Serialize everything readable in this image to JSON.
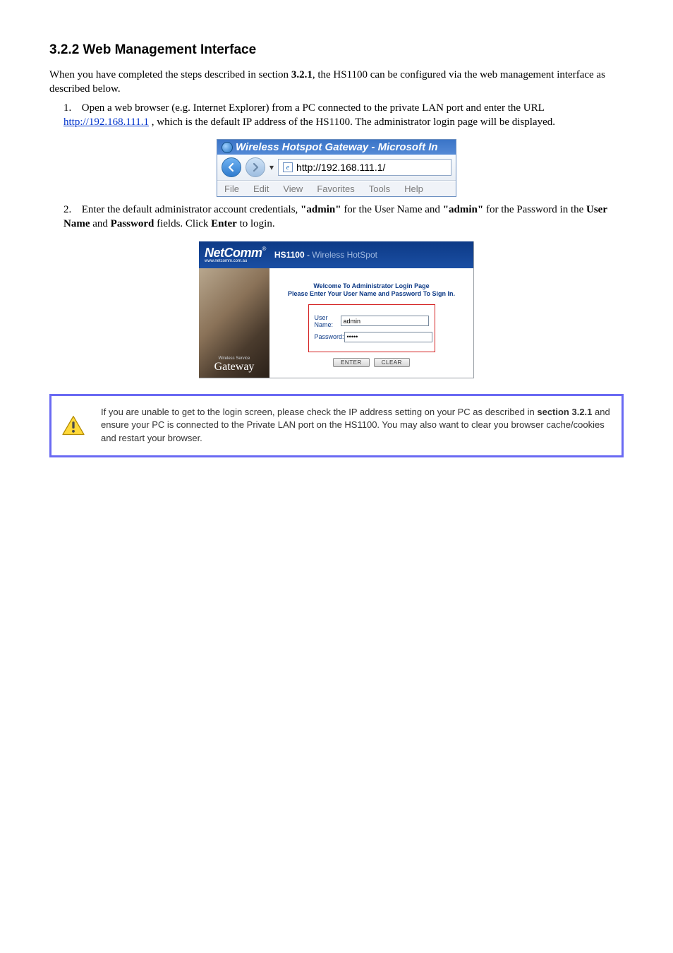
{
  "section_heading": "3.2.2 Web Management Interface",
  "intro_sentence_pre": "When you have completed the steps described in section ",
  "intro_sentence_ref": "3.2.1",
  "intro_sentence_post": ", the HS1100 can be configured via the web management interface as described below.",
  "steps": {
    "s1": {
      "text_pre": "Open a web browser (e.g. Internet Explorer) from a PC connected to the private LAN port and enter the URL ",
      "url": "http://192.168.111.1",
      "text_post": " , which is the default IP address of the HS1100. The administrator login page will be displayed."
    },
    "s2_line1_pre": "Enter the default administrator account credentials, ",
    "s2_user_value": "\"admin\"",
    "s2_line1_mid": " for the User Name and ",
    "s2_pass_value": "\"admin\"",
    "s2_line1_post": " for the Password in the ",
    "s2_user_field": "User Name",
    "s2_and": " and ",
    "s2_pass_field": "Password",
    "s2_line2": " fields. Click ",
    "s2_enter": "Enter",
    "s2_line3": " to login."
  },
  "ie": {
    "title": "Wireless Hotspot Gateway - Microsoft In",
    "address": "http://192.168.111.1/",
    "menus": [
      "File",
      "Edit",
      "View",
      "Favorites",
      "Tools",
      "Help"
    ]
  },
  "router": {
    "brand": "NetComm",
    "brand_reg": "®",
    "brand_sub": "www.netcomm.com.au",
    "product_code": "HS1100",
    "product_sep": " - ",
    "product_name": "Wireless HotSpot",
    "side_top": "Wireless Service",
    "side_main": "Gateway",
    "welcome": "Welcome To Administrator Login Page",
    "please": "Please Enter Your User Name and Password To Sign In.",
    "username_label": "User Name:",
    "username_value": "admin",
    "password_label": "Password:",
    "password_value": "•••••",
    "btn_enter": "ENTER",
    "btn_clear": "CLEAR"
  },
  "notice": {
    "line1_pre": "If you are unable to get to the login screen, please check the IP address setting on your PC as described in ",
    "line1_ref": "section 3.2.1",
    "line1_post": " and ensure your PC is connected to the Private LAN port on the HS1100. You may also want to clear you browser cache/cookies and restart your browser."
  }
}
